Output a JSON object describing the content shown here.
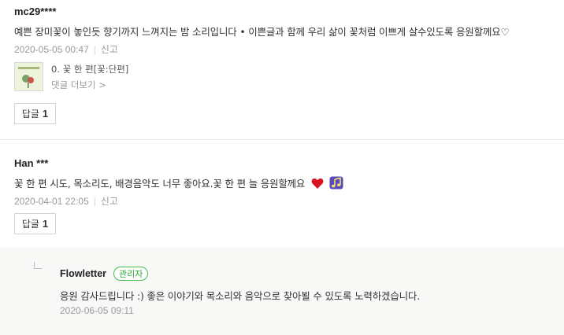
{
  "comments": [
    {
      "author": "mc29****",
      "text": "예쁜 장미꽃이 놓인듯 향기까지 느껴지는 밤 소리입니다 • 이쁜글과 함께 우리 삶이 꽃처럼 이쁘게 살수있도록 응원할께요♡",
      "date": "2020-05-05 00:47",
      "report_label": "신고",
      "post": {
        "title": "0. 꽃 한 편[꽃:단편]",
        "more_label": "댓글 더보기 >"
      },
      "reply_label": "답글",
      "reply_count": "1"
    },
    {
      "author": "Han ***",
      "text": "꽃 한 편 시도, 목소리도, 배경음악도 너무 좋아요.꽃 한 편 늘 응원할께요",
      "date": "2020-04-01 22:05",
      "report_label": "신고",
      "reply_label": "답글",
      "reply_count": "1",
      "emoji": [
        "heart-icon",
        "music-note-icon"
      ]
    }
  ],
  "reply": {
    "author": "Flowletter",
    "badge": "관리자",
    "text": "응원 감사드립니다 :) 좋은 이야기와 목소리와 음악으로 찾아뵐 수 있도록 노력하겠습니다.",
    "date": "2020-06-05 09:11"
  },
  "colors": {
    "badge": "#47bc51",
    "reply_bg": "#f8f9f7",
    "meta": "#9a9a9a"
  }
}
